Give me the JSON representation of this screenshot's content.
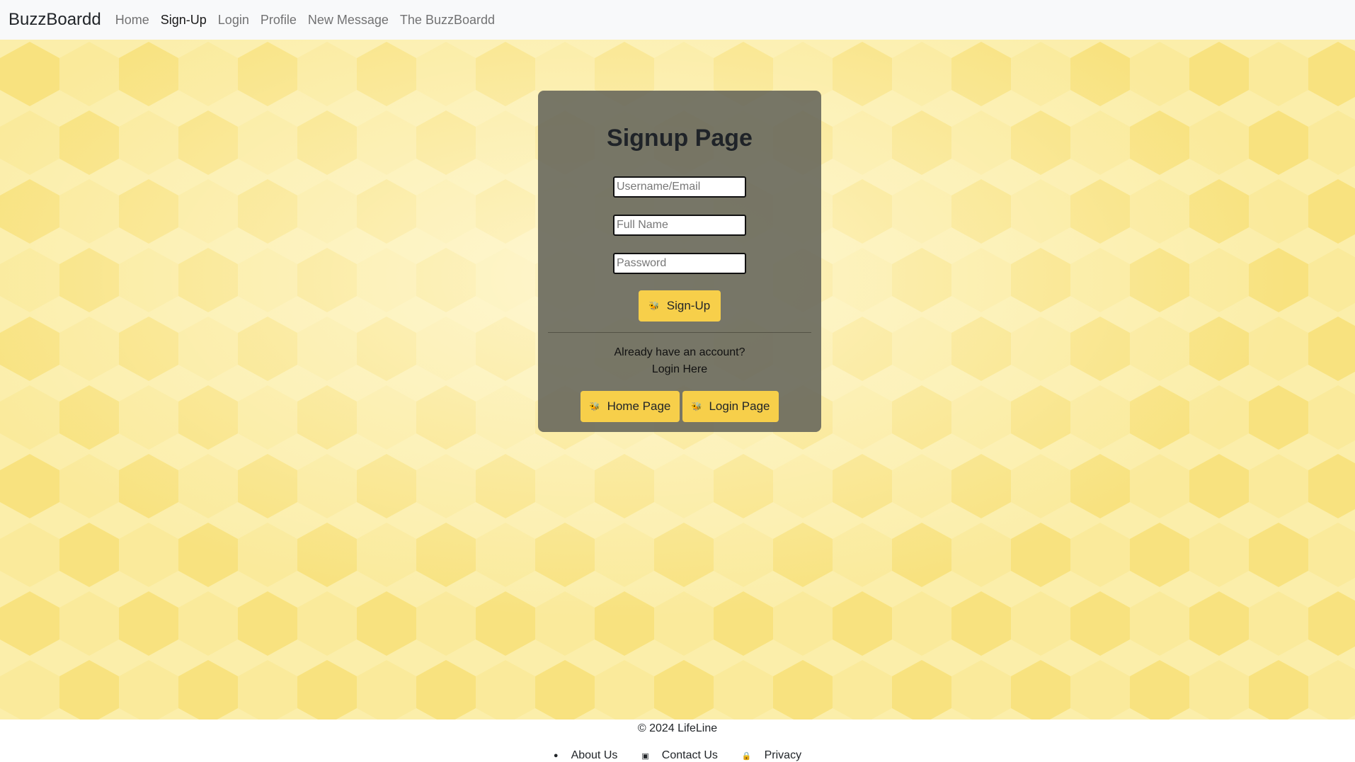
{
  "navbar": {
    "brand": "BuzzBoardd",
    "links": [
      {
        "label": "Home"
      },
      {
        "label": "Sign-Up"
      },
      {
        "label": "Login"
      },
      {
        "label": "Profile"
      },
      {
        "label": "New Message"
      },
      {
        "label": "The BuzzBoardd"
      }
    ],
    "active": "Sign-Up"
  },
  "signup": {
    "title": "Signup Page",
    "username_placeholder": "Username/Email",
    "fullname_placeholder": "Full Name",
    "password_placeholder": "Password",
    "submit_label": "Sign-Up",
    "account_text": "Already have an account?",
    "login_link": "Login Here",
    "home_button": "Home Page",
    "login_button": "Login Page"
  },
  "icons": {
    "button_icon": "bee-icon",
    "about_icon": "info-circle-icon",
    "contact_icon": "contact-card-icon",
    "privacy_icon": "lock-icon"
  },
  "footer": {
    "copyright": "© 2024 LifeLine",
    "links": [
      {
        "label": "About Us"
      },
      {
        "label": "Contact Us"
      },
      {
        "label": "Privacy"
      }
    ]
  },
  "colors": {
    "accent": "#f7cf4a",
    "background": "#fbeeaa",
    "card": "#64645a"
  }
}
